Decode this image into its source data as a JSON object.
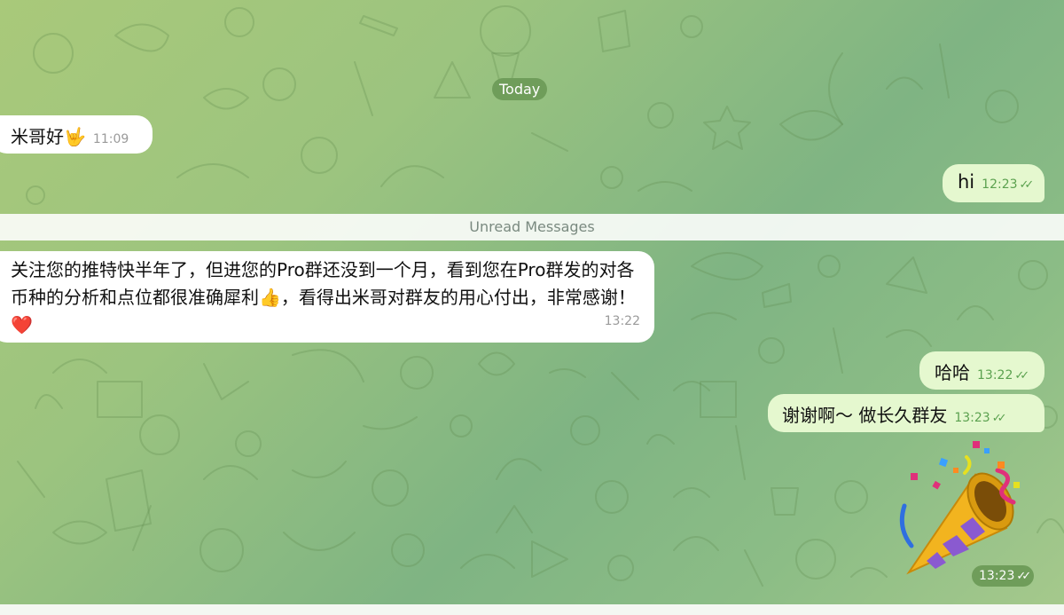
{
  "chat": {
    "date_label": "Today",
    "unread_label": "Unread Messages",
    "messages": [
      {
        "direction": "in",
        "text": "米哥好",
        "emoji": "🤟",
        "time": "11:09"
      },
      {
        "direction": "out",
        "text": "hi",
        "time": "12:23",
        "status": "read"
      },
      {
        "direction": "in",
        "text": "关注您的推特快半年了，但进您的Pro群还没到一个月，看到您在Pro群发的对各币种的分析和点位都很准确犀利👍，看得出米哥对群友的用心付出，非常感谢！❤️",
        "time": "13:22"
      },
      {
        "direction": "out",
        "text": "哈哈",
        "time": "13:22",
        "status": "read"
      },
      {
        "direction": "out",
        "text": "谢谢啊～ 做长久群友",
        "time": "13:23",
        "status": "read"
      },
      {
        "direction": "out",
        "type": "sticker",
        "sticker": "party-popper",
        "time": "13:23",
        "status": "read"
      }
    ]
  },
  "icons": {
    "read_receipt": "double-check-icon",
    "sticker": "party-popper-icon"
  },
  "colors": {
    "incoming_bubble": "#ffffff",
    "outgoing_bubble": "#e5f8cf",
    "time_outgoing": "#5ba14f",
    "date_pill": "#6f9d5a",
    "background_start": "#a9c97a",
    "background_end": "#7fb483"
  }
}
